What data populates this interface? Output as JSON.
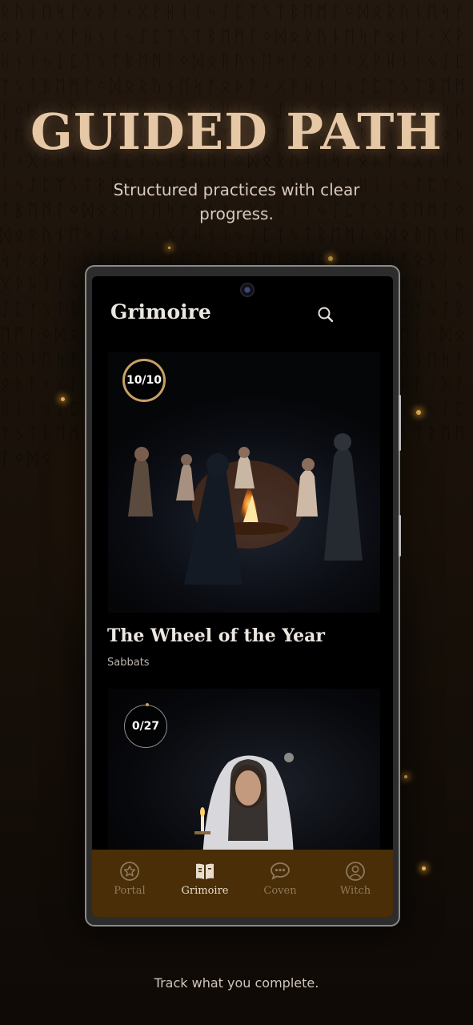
{
  "headline": "GUIDED PATH",
  "subtitle": "Structured practices with clear progress.",
  "footer_caption": "Track what you complete.",
  "colors": {
    "accent_gold": "#c9a063",
    "nav_background": "#4a2e08",
    "background": "#1a120a"
  },
  "app": {
    "title": "Grimoire",
    "search_icon": "search-icon",
    "cards": [
      {
        "progress": "10/10",
        "progress_completed": 10,
        "progress_total": 10,
        "title": "The Wheel of the Year",
        "subtitle": "Sabbats"
      },
      {
        "progress": "0/27",
        "progress_completed": 0,
        "progress_total": 27
      }
    ],
    "nav": [
      {
        "label": "Portal",
        "icon": "star-circle-icon",
        "active": false
      },
      {
        "label": "Grimoire",
        "icon": "open-book-icon",
        "active": true
      },
      {
        "label": "Coven",
        "icon": "chat-bubble-icon",
        "active": false
      },
      {
        "label": "Witch",
        "icon": "user-circle-icon",
        "active": false
      }
    ]
  }
}
